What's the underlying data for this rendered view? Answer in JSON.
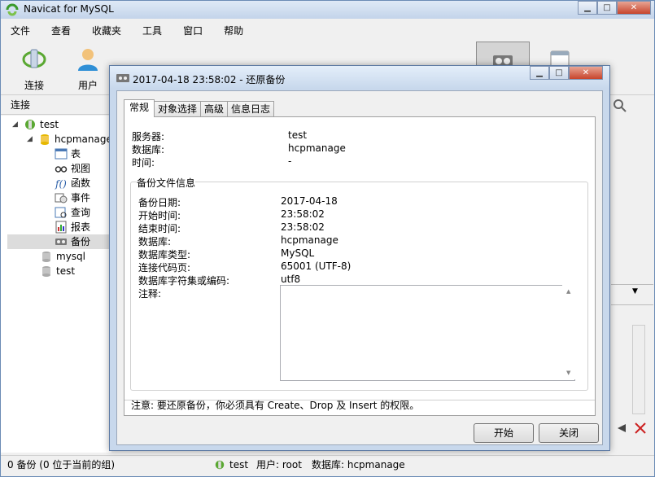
{
  "app": {
    "title": "Navicat for MySQL"
  },
  "menubar": [
    "文件",
    "查看",
    "收藏夹",
    "工具",
    "窗口",
    "帮助"
  ],
  "toolbar": {
    "connect_label": "连接",
    "user_label": "用户"
  },
  "sidebar": {
    "header": "连接",
    "tree": {
      "root": "test",
      "db": "hcpmanage",
      "children": [
        "表",
        "视图",
        "函数",
        "事件",
        "查询",
        "报表",
        "备份"
      ],
      "others": [
        "mysql",
        "test"
      ]
    }
  },
  "statusbar": {
    "left": "0 备份 (0 位于当前的组)",
    "connection": "test",
    "user": "用户: root",
    "database": "数据库: hcpmanage"
  },
  "dialog": {
    "title": "2017-04-18 23:58:02 - 还原备份",
    "tabs": [
      "常规",
      "对象选择",
      "高级",
      "信息日志"
    ],
    "general": {
      "server_label": "服务器:",
      "server_value": "test",
      "database_label": "数据库:",
      "database_value": "hcpmanage",
      "time_label": "时间:",
      "time_value": "-"
    },
    "backup_info": {
      "group_title": "备份文件信息",
      "rows": [
        {
          "label": "备份日期:",
          "value": "2017-04-18"
        },
        {
          "label": "开始时间:",
          "value": "23:58:02"
        },
        {
          "label": "结束时间:",
          "value": "23:58:02"
        },
        {
          "label": "数据库:",
          "value": "hcpmanage"
        },
        {
          "label": "数据库类型:",
          "value": "MySQL"
        },
        {
          "label": "连接代码页:",
          "value": "65001 (UTF-8)"
        },
        {
          "label": "数据库字符集或编码:",
          "value": "utf8"
        }
      ],
      "notes_label": "注释:",
      "notes_value": ""
    },
    "footer_note": "注意: 要还原备份，你必须具有 Create、Drop 及 Insert 的权限。",
    "start_button": "开始",
    "close_button": "关闭"
  }
}
